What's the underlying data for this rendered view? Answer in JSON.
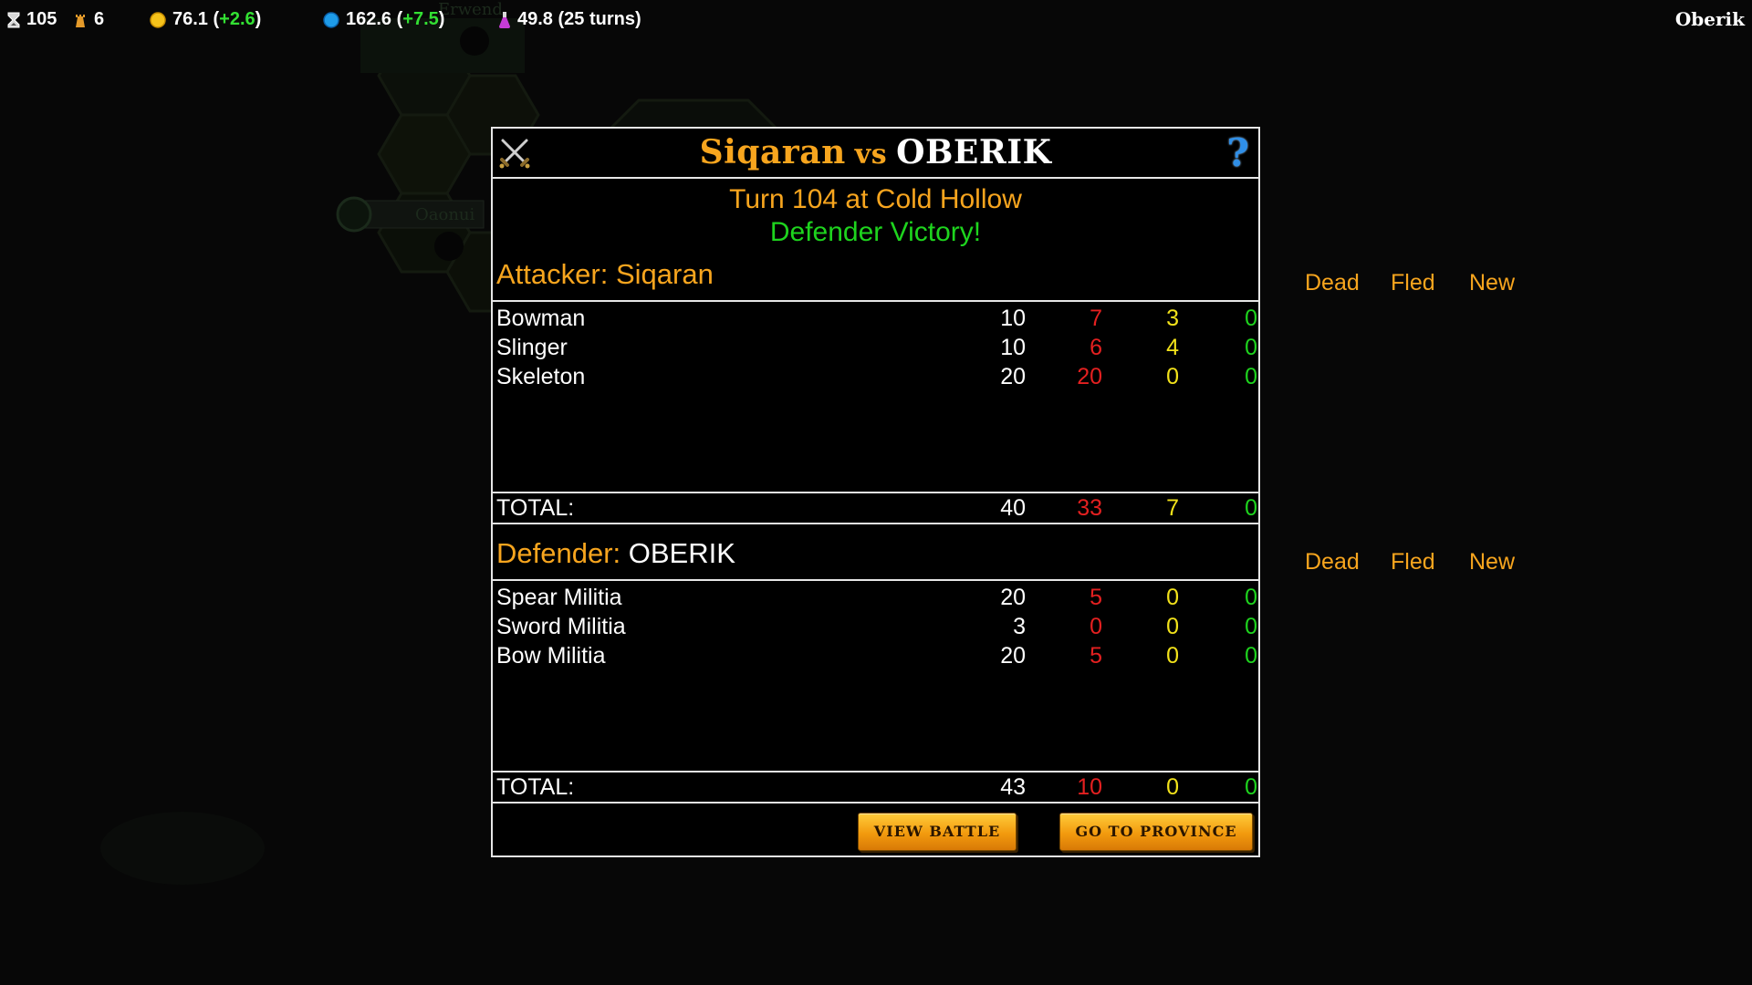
{
  "topbar": {
    "turn": "105",
    "cities": "6",
    "gold": "76.1",
    "gold_delta": "+2.6",
    "mana": "162.6",
    "mana_delta": "+7.5",
    "research": "49.8 (25 turns)",
    "player": "Oberik",
    "icons": [
      "hourglass-icon",
      "tower-icon",
      "gold-coin-icon",
      "mana-orb-icon",
      "potion-icon"
    ]
  },
  "map": {
    "labels": [
      "Erwend",
      "Oaonui"
    ]
  },
  "battle": {
    "attacker_name": "Siqaran",
    "vs": "vs",
    "defender_name": "OBERIK",
    "subtitle": "Turn 104 at Cold Hollow",
    "outcome": "Defender Victory!",
    "columns": {
      "dead": "Dead",
      "fled": "Fled",
      "new": "New"
    },
    "attacker": {
      "label": "Attacker:",
      "name": "Siqaran",
      "units": [
        {
          "name": "Bowman",
          "count": "10",
          "dead": "7",
          "fled": "3",
          "new": "0"
        },
        {
          "name": "Slinger",
          "count": "10",
          "dead": "6",
          "fled": "4",
          "new": "0"
        },
        {
          "name": "Skeleton",
          "count": "20",
          "dead": "20",
          "fled": "0",
          "new": "0"
        }
      ],
      "total": {
        "label": "TOTAL:",
        "count": "40",
        "dead": "33",
        "fled": "7",
        "new": "0"
      }
    },
    "defender": {
      "label": "Defender:",
      "name": "OBERIK",
      "units": [
        {
          "name": "Spear Militia",
          "count": "20",
          "dead": "5",
          "fled": "0",
          "new": "0"
        },
        {
          "name": "Sword Militia",
          "count": "3",
          "dead": "0",
          "fled": "0",
          "new": "0"
        },
        {
          "name": "Bow Militia",
          "count": "20",
          "dead": "5",
          "fled": "0",
          "new": "0"
        }
      ],
      "total": {
        "label": "TOTAL:",
        "count": "43",
        "dead": "10",
        "fled": "0",
        "new": "0"
      }
    },
    "buttons": {
      "view_battle": "VIEW BATTLE",
      "go_to_province": "GO TO PROVINCE"
    },
    "colors": {
      "accent": "#f7a51e",
      "dead": "#e42020",
      "fled": "#f2e21a",
      "new": "#1ed41e"
    }
  }
}
